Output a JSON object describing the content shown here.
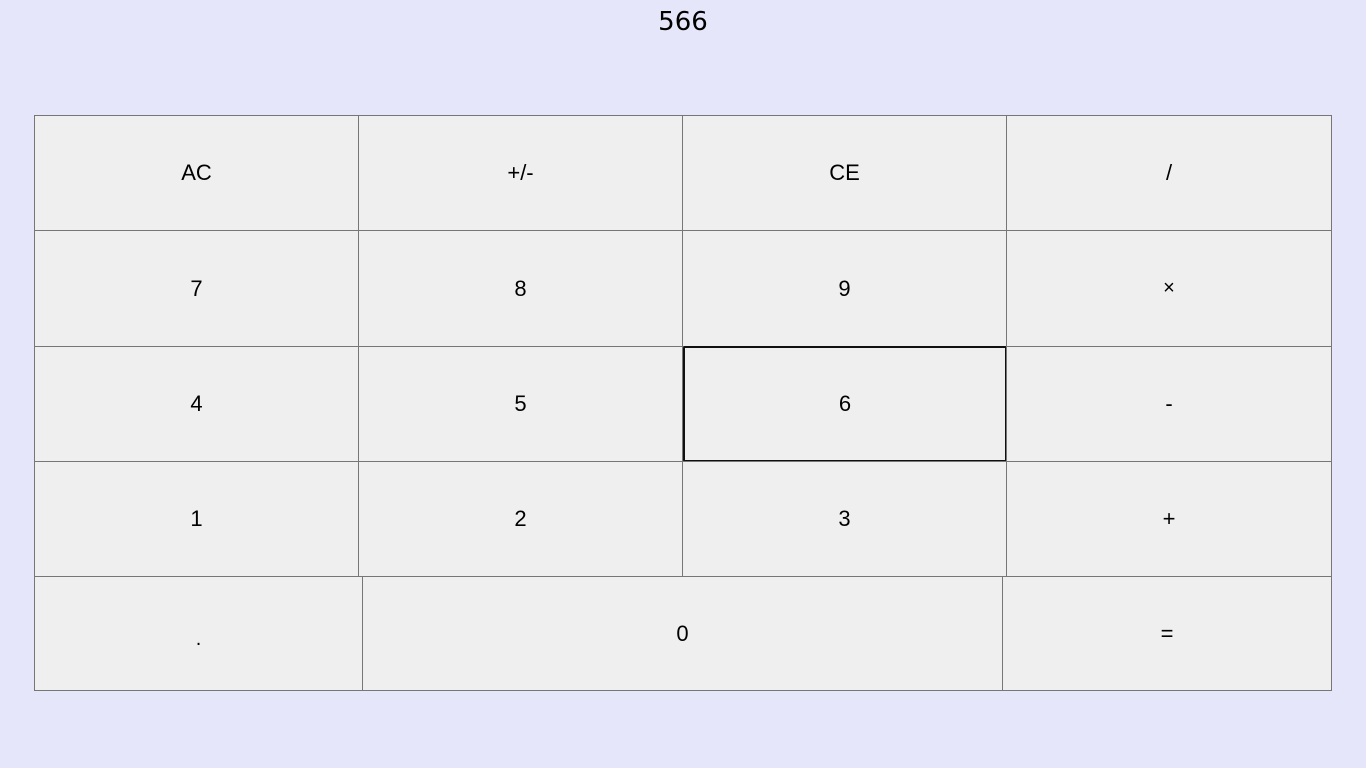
{
  "display": {
    "value": "566"
  },
  "keys": {
    "ac": "AC",
    "negate": "+/-",
    "ce": "CE",
    "divide": "/",
    "seven": "7",
    "eight": "8",
    "nine": "9",
    "multiply": "×",
    "four": "4",
    "five": "5",
    "six": "6",
    "subtract": "-",
    "one": "1",
    "two": "2",
    "three": "3",
    "add": "+",
    "decimal": ".",
    "zero": "0",
    "equals": "="
  },
  "focused_key": "six",
  "colors": {
    "background": "#e6e6fa",
    "key_background": "#efefef",
    "key_border": "#767676",
    "focus_border": "#101010"
  }
}
